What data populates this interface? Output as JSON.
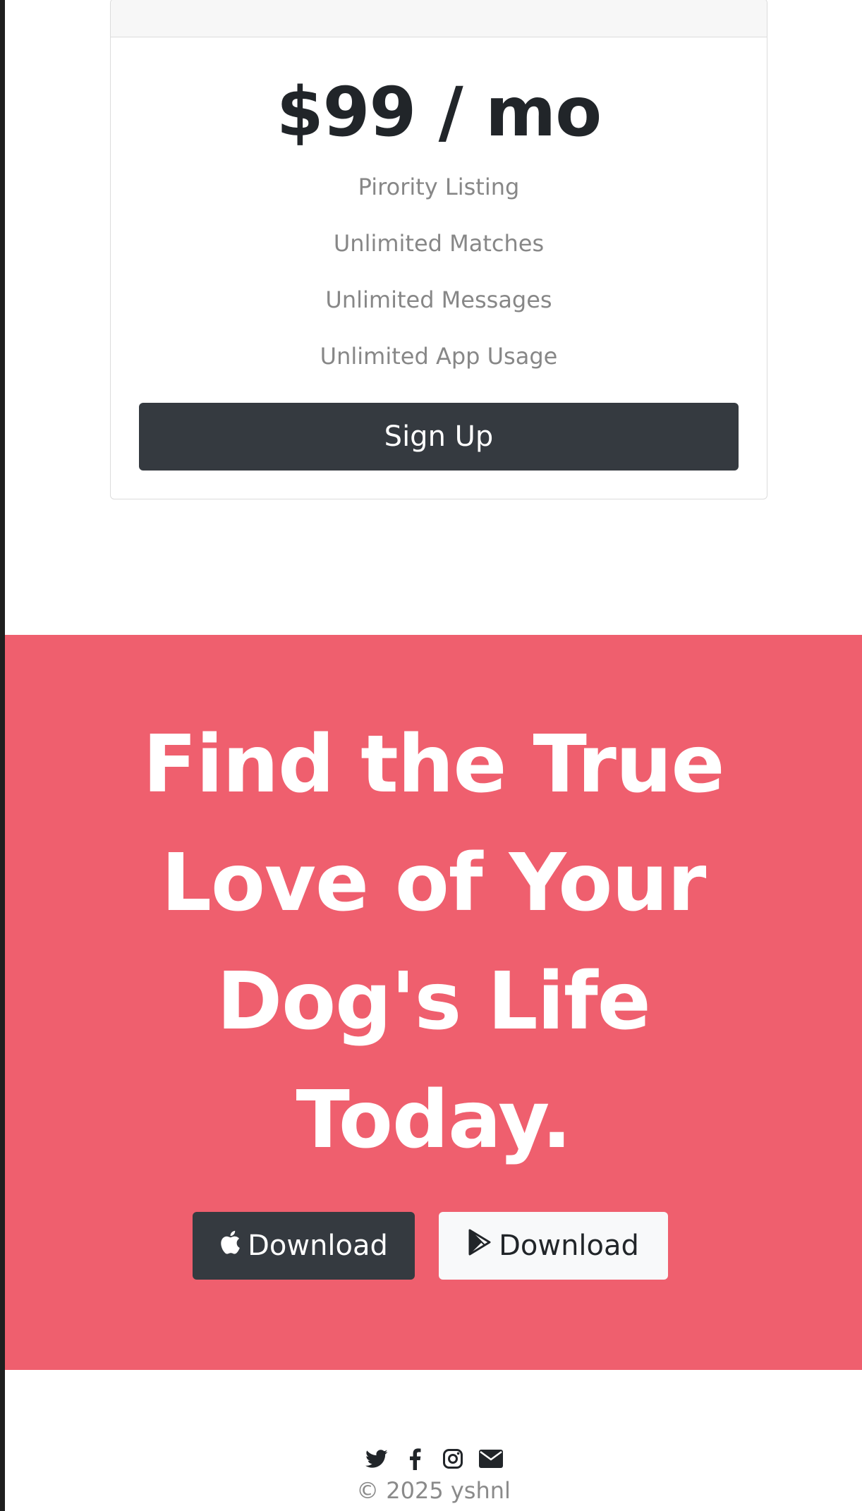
{
  "pricing": {
    "price": "$99 / mo",
    "features": [
      "Pirority Listing",
      "Unlimited Matches",
      "Unlimited Messages",
      "Unlimited App Usage"
    ],
    "signup_label": "Sign Up"
  },
  "cta": {
    "heading": "Find the True Love of Your Dog's Life Today.",
    "buttons": [
      {
        "label": "Download",
        "icon": "apple-icon"
      },
      {
        "label": "Download",
        "icon": "google-play-icon"
      }
    ],
    "background": "#ef5f6e"
  },
  "footer": {
    "social_icons": [
      "twitter-icon",
      "facebook-icon",
      "instagram-icon",
      "envelope-icon"
    ],
    "copyright": "© 2025 yshnl"
  },
  "colors": {
    "dark_button": "#353a40",
    "light_button": "#f8f9fa",
    "muted_text": "#878787"
  }
}
